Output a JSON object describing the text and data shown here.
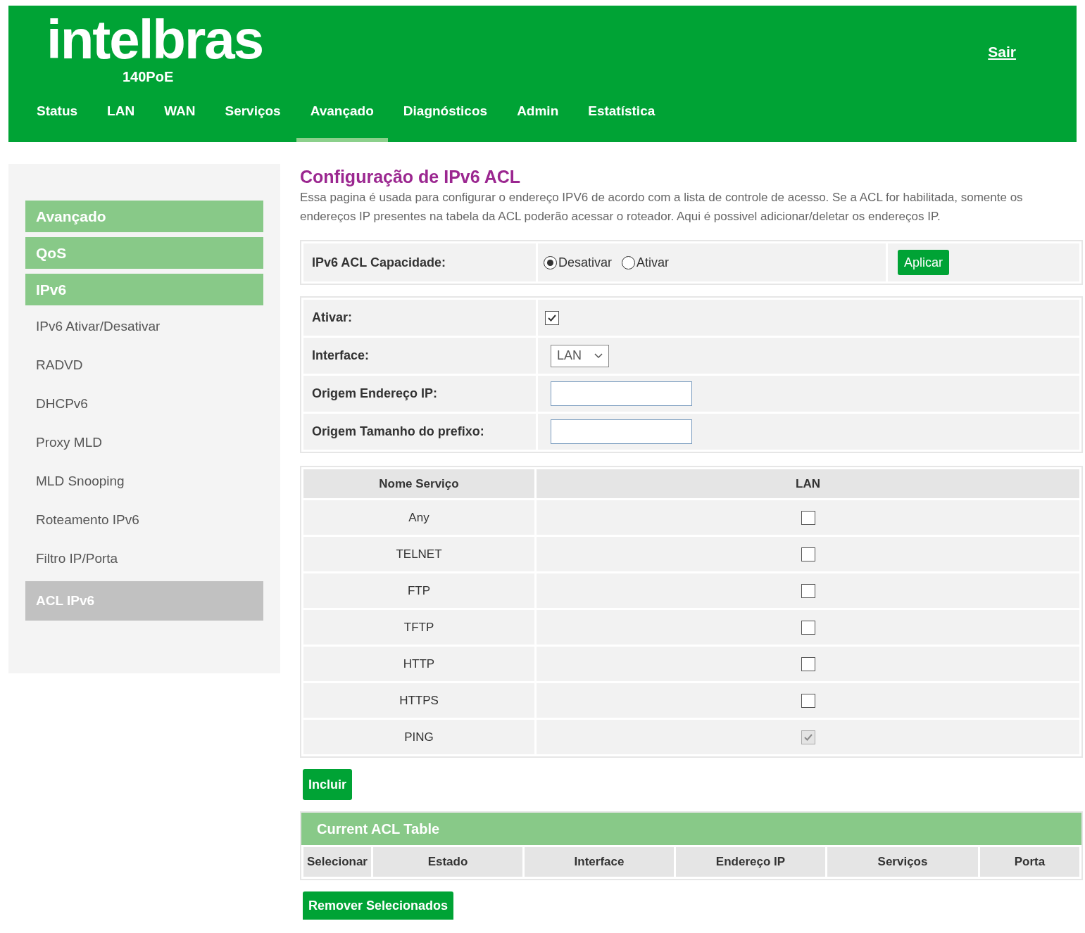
{
  "header": {
    "logo": "intelbras",
    "model": "140PoE",
    "logout": "Sair"
  },
  "nav": [
    {
      "label": "Status",
      "selected": false
    },
    {
      "label": "LAN",
      "selected": false
    },
    {
      "label": "WAN",
      "selected": false
    },
    {
      "label": "Serviços",
      "selected": false
    },
    {
      "label": "Avançado",
      "selected": true
    },
    {
      "label": "Diagnósticos",
      "selected": false
    },
    {
      "label": "Admin",
      "selected": false
    },
    {
      "label": "Estatística",
      "selected": false
    }
  ],
  "sidebar": {
    "items": [
      {
        "label": "Avançado",
        "kind": "header"
      },
      {
        "label": "QoS",
        "kind": "header"
      },
      {
        "label": "IPv6",
        "kind": "header"
      },
      {
        "label": "IPv6 Ativar/Desativar",
        "kind": "link",
        "selected": false
      },
      {
        "label": "RADVD",
        "kind": "link",
        "selected": false
      },
      {
        "label": "DHCPv6",
        "kind": "link",
        "selected": false
      },
      {
        "label": "Proxy MLD",
        "kind": "link",
        "selected": false
      },
      {
        "label": "MLD Snooping",
        "kind": "link",
        "selected": false
      },
      {
        "label": "Roteamento IPv6",
        "kind": "link",
        "selected": false
      },
      {
        "label": "Filtro IP/Porta",
        "kind": "link",
        "selected": false
      },
      {
        "label": "ACL IPv6",
        "kind": "link",
        "selected": true
      }
    ]
  },
  "title": "Configuração de IPv6 ACL",
  "description": "Essa pagina é usada para configurar o endereço IPV6 de acordo com a lista de controle de acesso. Se a ACL for habilitada, somente os endereços IP presentes na tabela da ACL poderão acessar o roteador. Aqui é possivel adicionar/deletar os endereços IP.",
  "capability": {
    "label": "IPv6 ACL Capacidade:",
    "options": [
      {
        "label": "Desativar",
        "selected": true
      },
      {
        "label": "Ativar",
        "selected": false
      }
    ],
    "button": "Aplicar"
  },
  "form": {
    "enable": {
      "label": "Ativar:",
      "checked": true
    },
    "interface": {
      "label": "Interface:",
      "value": "LAN"
    },
    "source_ip": {
      "label": "Origem Endereço IP:"
    },
    "prefix": {
      "label": "Origem Tamanho do prefixo:"
    }
  },
  "services": {
    "columns": [
      "Nome Serviço",
      "LAN"
    ],
    "rows": [
      {
        "name": "Any",
        "checked": false,
        "disabled": false
      },
      {
        "name": "TELNET",
        "checked": false,
        "disabled": false
      },
      {
        "name": "FTP",
        "checked": false,
        "disabled": false
      },
      {
        "name": "TFTP",
        "checked": false,
        "disabled": false
      },
      {
        "name": "HTTP",
        "checked": false,
        "disabled": false
      },
      {
        "name": "HTTPS",
        "checked": false,
        "disabled": false
      },
      {
        "name": "PING",
        "checked": true,
        "disabled": true
      }
    ]
  },
  "add_button": "Incluir",
  "acl_table": {
    "title": "Current ACL Table",
    "columns": [
      "Selecionar",
      "Estado",
      "Interface",
      "Endereço IP",
      "Serviços",
      "Porta"
    ]
  },
  "remove_button": "Remover Selecionados"
}
